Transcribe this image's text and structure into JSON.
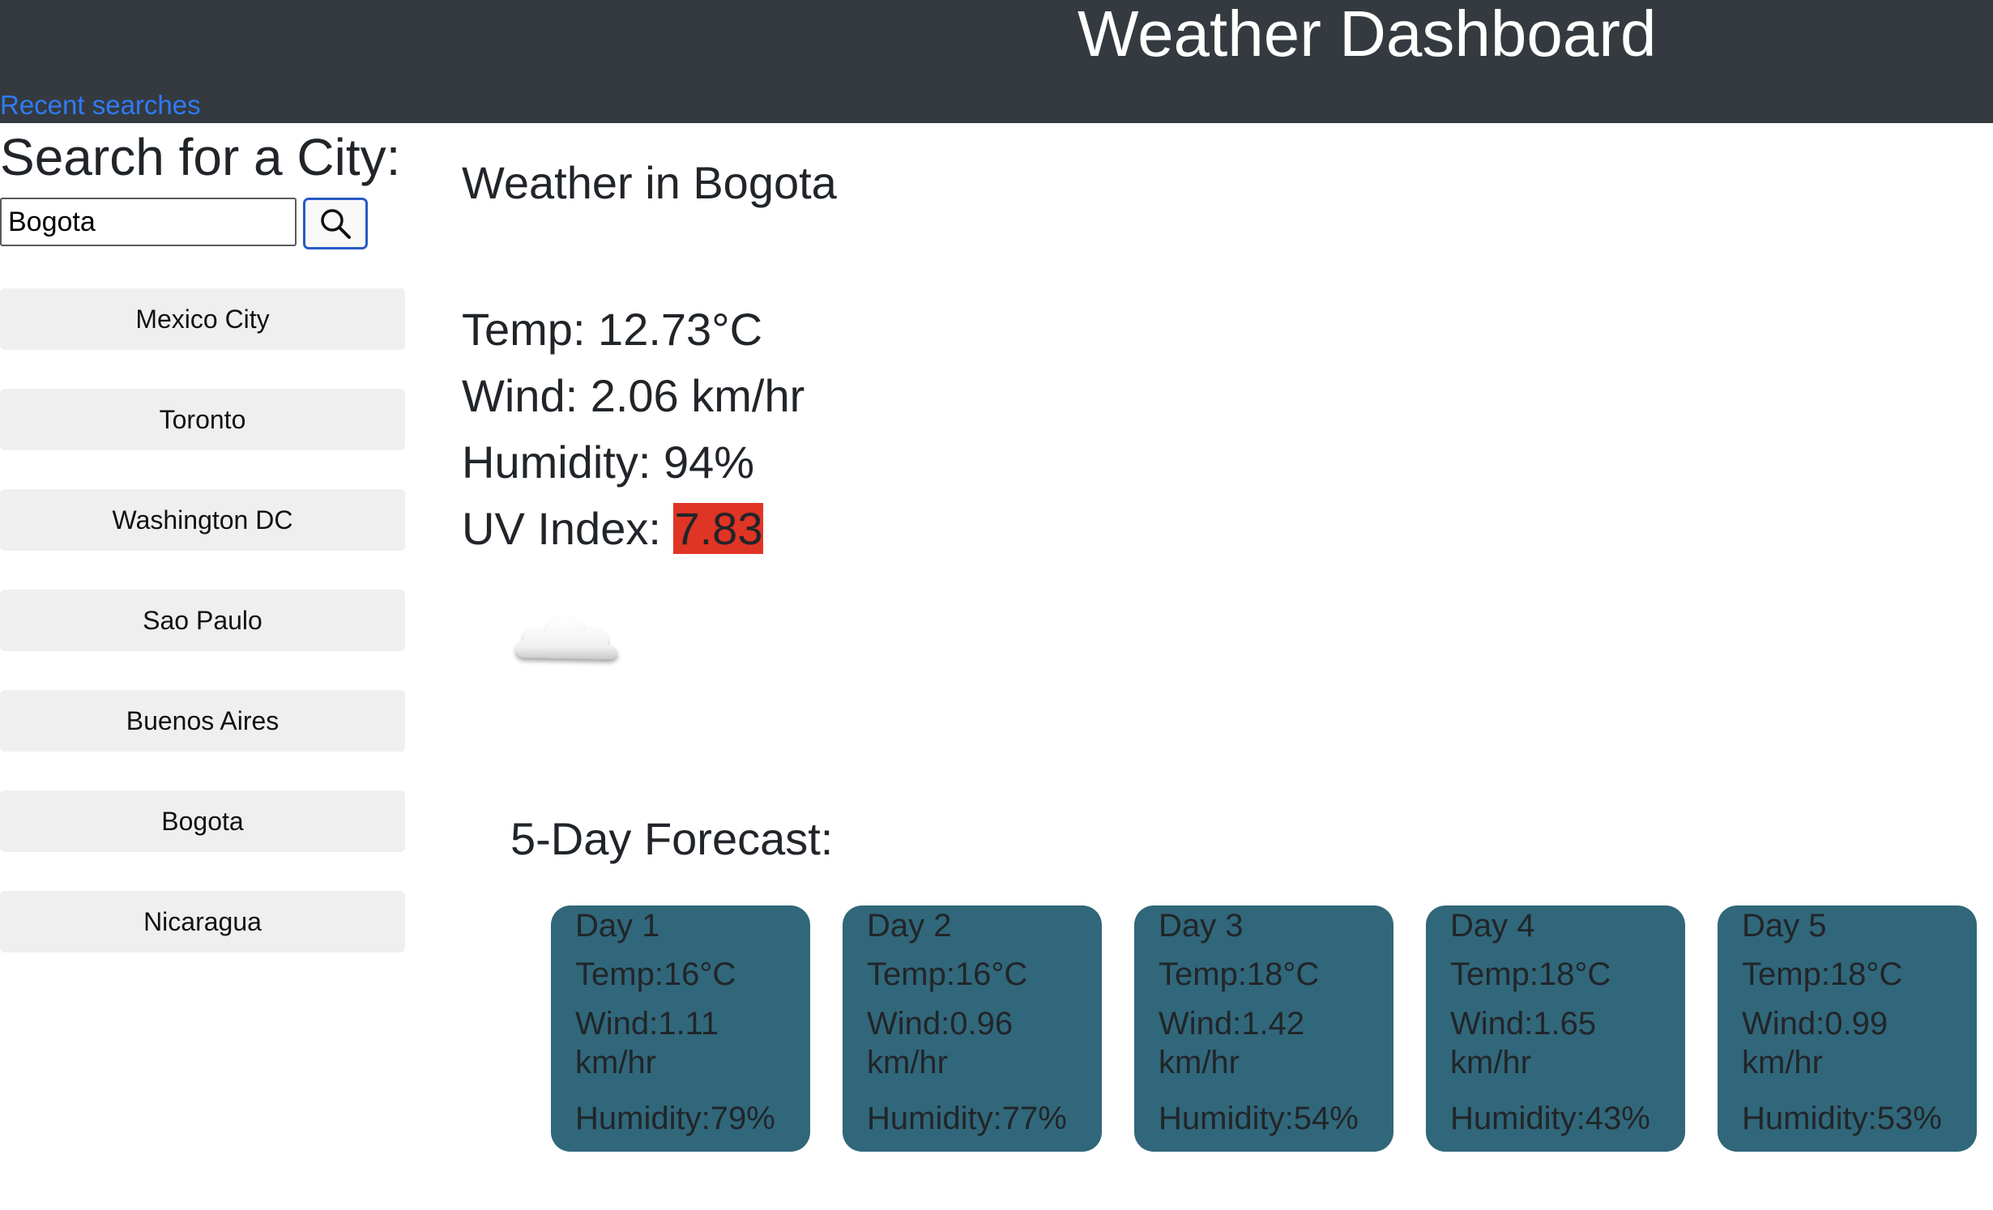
{
  "header": {
    "title": "Weather Dashboard",
    "recent_link": "Recent searches"
  },
  "search": {
    "heading": "Search for a City:",
    "value": "Bogota",
    "button_icon": "search-icon"
  },
  "recent_cities": [
    "Mexico City",
    "Toronto",
    "Washington DC",
    "Sao Paulo",
    "Buenos Aires",
    "Bogota",
    "Nicaragua"
  ],
  "current": {
    "title": "Weather in Bogota",
    "temp": "Temp: 12.73°C",
    "wind": "Wind: 2.06 km/hr",
    "humidity": "Humidity: 94%",
    "uv_label": "UV Index: ",
    "uv_value": "7.83",
    "uv_color": "#e03425",
    "icon": "cloud-icon"
  },
  "forecast": {
    "title": "5-Day Forecast:",
    "card_color": "#31677a",
    "days": [
      {
        "day": "Day 1",
        "temp": "Temp:16°C",
        "wind": "Wind:1.11 km/hr",
        "humidity": "Humidity:79%"
      },
      {
        "day": "Day 2",
        "temp": "Temp:16°C",
        "wind": "Wind:0.96 km/hr",
        "humidity": "Humidity:77%"
      },
      {
        "day": "Day 3",
        "temp": "Temp:18°C",
        "wind": "Wind:1.42 km/hr",
        "humidity": "Humidity:54%"
      },
      {
        "day": "Day 4",
        "temp": "Temp:18°C",
        "wind": "Wind:1.65 km/hr",
        "humidity": "Humidity:43%"
      },
      {
        "day": "Day 5",
        "temp": "Temp:18°C",
        "wind": "Wind:0.99 km/hr",
        "humidity": "Humidity:53%"
      }
    ]
  }
}
